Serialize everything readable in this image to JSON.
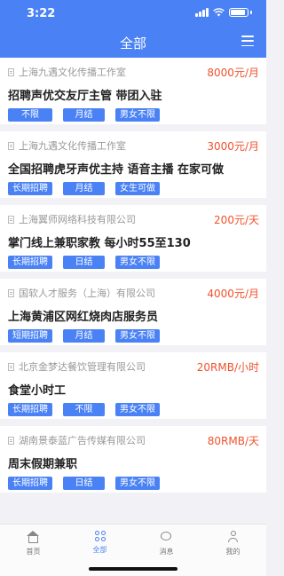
{
  "status_bar": {
    "time": "3:22"
  },
  "header": {
    "title": "全部"
  },
  "jobs": [
    {
      "company": "上海九遇文化传播工作室",
      "salary": "8000元/月",
      "title": "招聘声优交友厅主管 带团入驻",
      "tags": [
        "不限",
        "月结",
        "男女不限"
      ]
    },
    {
      "company": "上海九遇文化传播工作室",
      "salary": "3000元/月",
      "title": "全国招聘虎牙声优主持  语音主播 在家可做",
      "tags": [
        "长期招聘",
        "月结",
        "女生可做"
      ]
    },
    {
      "company": "上海翼师网络科技有限公司",
      "salary": "200元/天",
      "title": "掌门线上兼职家教 每小时55至130",
      "tags": [
        "长期招聘",
        "日结",
        "男女不限"
      ]
    },
    {
      "company": "国软人才服务（上海）有限公司",
      "salary": "4000元/月",
      "title": "上海黄浦区网红烧肉店服务员",
      "tags": [
        "短期招聘",
        "月结",
        "男女不限"
      ]
    },
    {
      "company": "北京金梦达餐饮管理有限公司",
      "salary": "20RMB/小时",
      "title": "食堂小时工",
      "tags": [
        "长期招聘",
        "不限",
        "男女不限"
      ]
    },
    {
      "company": "湖南景泰蓝广告传媒有限公司",
      "salary": "80RMB/天",
      "title": "周末假期兼职",
      "tags": [
        "长期招聘",
        "日结",
        "男女不限"
      ]
    }
  ],
  "tabbar": {
    "items": [
      {
        "label": "首页",
        "icon": "home-icon"
      },
      {
        "label": "全部",
        "icon": "grid-icon"
      },
      {
        "label": "消息",
        "icon": "message-icon"
      },
      {
        "label": "我的",
        "icon": "user-icon"
      }
    ]
  },
  "colors": {
    "accent": "#4a82f5",
    "salary": "#f0522d",
    "background": "#f2f2f6"
  }
}
